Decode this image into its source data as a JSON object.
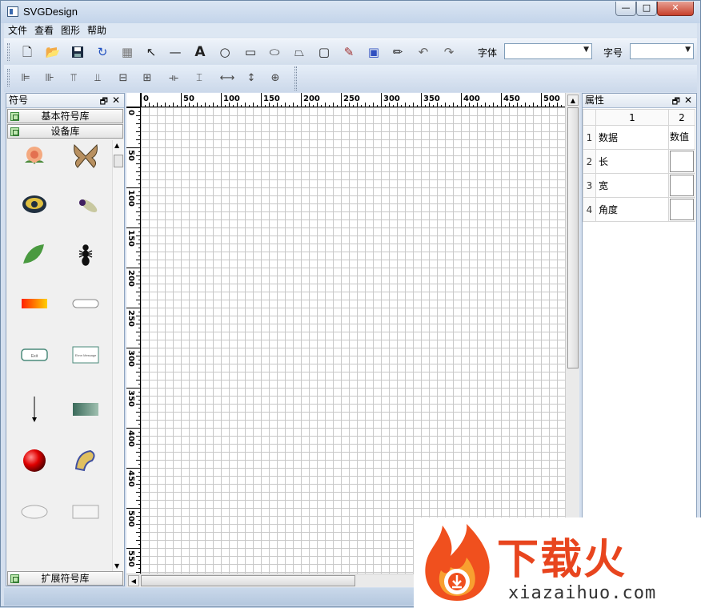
{
  "window": {
    "title": "SVGDesign",
    "min": "—",
    "max": "□",
    "close": "✕"
  },
  "menu": [
    "文件",
    "查看",
    "图形",
    "帮助"
  ],
  "toolbar": {
    "font_label": "字体",
    "size_label": "字号",
    "font_value": "",
    "size_value": ""
  },
  "left_panel": {
    "title": "符号",
    "libraries": [
      "基本符号库",
      "设备库",
      "扩展符号库"
    ]
  },
  "right_panel": {
    "title": "属性",
    "columns": [
      "1",
      "2"
    ],
    "rows": [
      {
        "n": "1",
        "name": "数据",
        "value": "数值"
      },
      {
        "n": "2",
        "name": "长",
        "value": ""
      },
      {
        "n": "3",
        "name": "宽",
        "value": ""
      },
      {
        "n": "4",
        "name": "角度",
        "value": ""
      }
    ]
  },
  "ruler": {
    "top": [
      "0",
      "50",
      "100",
      "150",
      "200",
      "250",
      "300",
      "350",
      "400",
      "450",
      "500"
    ],
    "left": [
      "0",
      "50",
      "100",
      "150",
      "200",
      "250",
      "300",
      "350",
      "400",
      "450",
      "500",
      "550"
    ]
  },
  "symbols": [
    "Exit",
    "Ehnn Message"
  ],
  "watermark": {
    "brand": "下载火",
    "url": "xiazaihuo.com"
  }
}
